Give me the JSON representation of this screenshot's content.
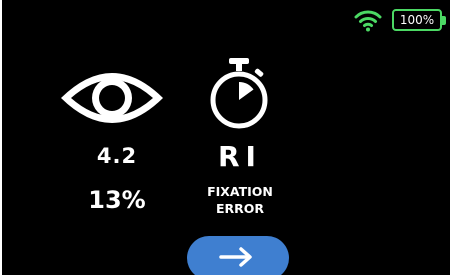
{
  "status_bar": {
    "battery_text": "100%",
    "wifi_icon": "wifi-icon",
    "battery_icon": "battery-icon",
    "accent_color": "#4cd964"
  },
  "results": {
    "eye_icon": "eye-icon",
    "timer_icon": "stopwatch-icon",
    "score": "4.2",
    "percent": "13%",
    "code": "RI",
    "error_label_line1": "FIXATION",
    "error_label_line2": "ERROR"
  },
  "next_button": {
    "icon": "arrow-right-icon",
    "color": "#3f7fd0"
  }
}
